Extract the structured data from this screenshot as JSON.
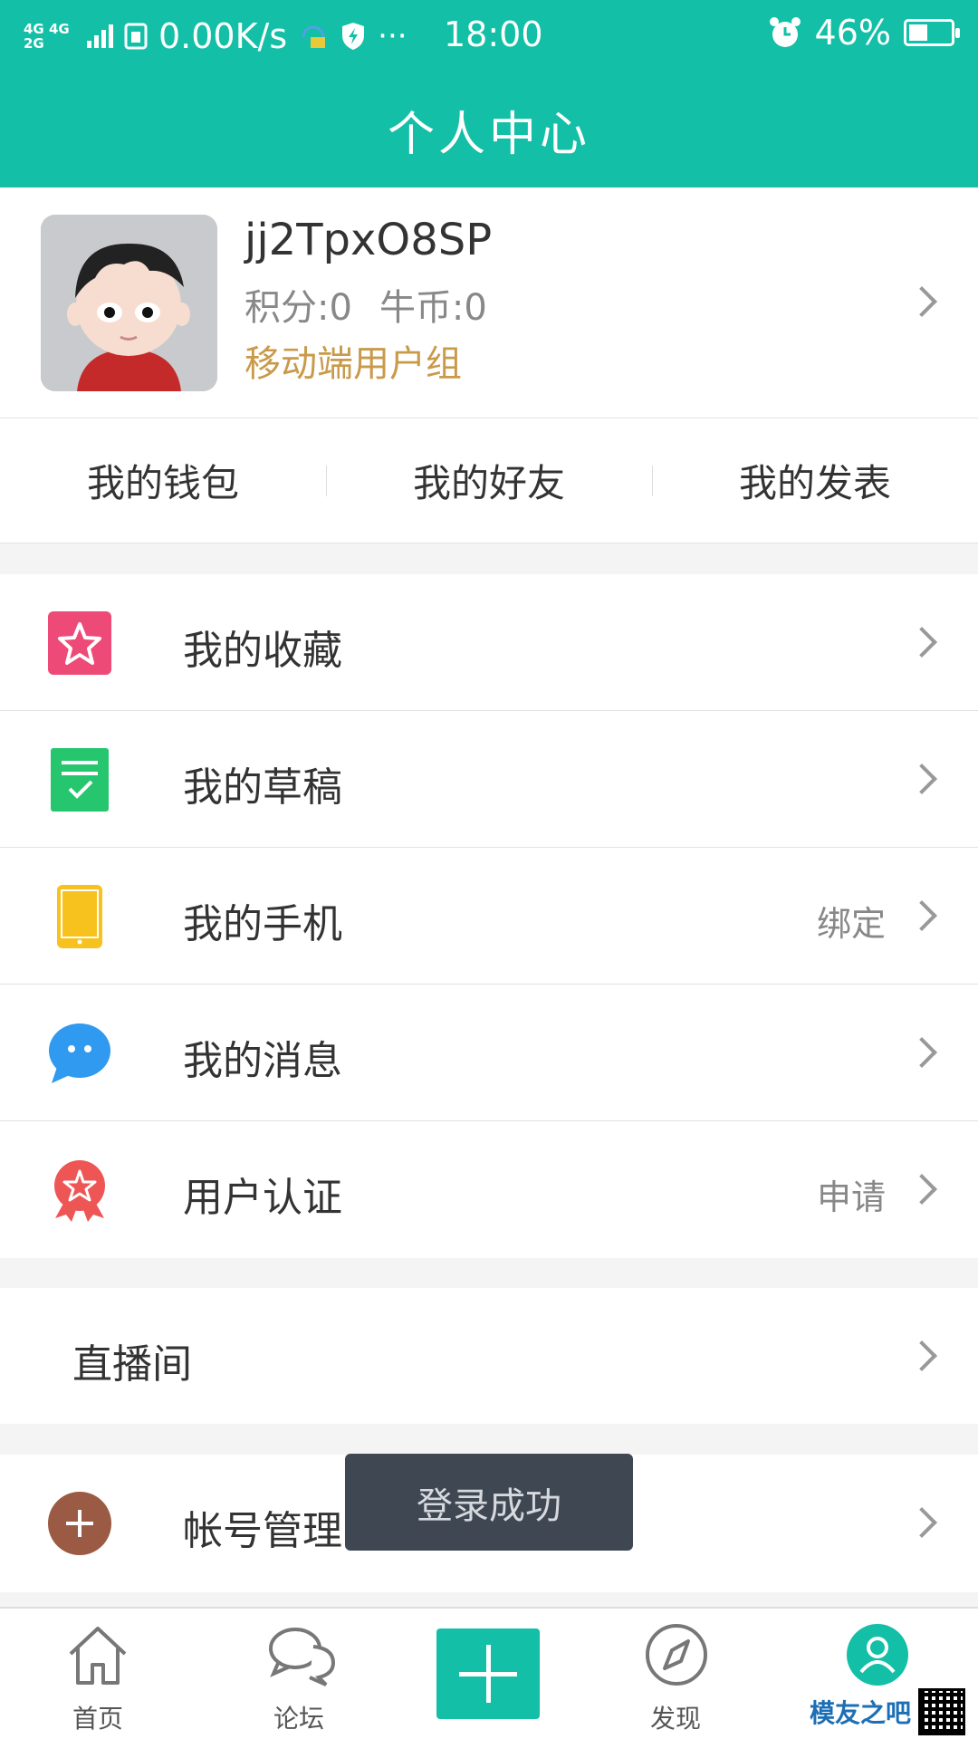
{
  "status_bar": {
    "network": "4G 4G 2G",
    "speed": "0.00K/s",
    "dots": "···",
    "time": "18:00",
    "battery": "46%",
    "battery_level": 0.46
  },
  "header": {
    "title": "个人中心"
  },
  "profile": {
    "username": "jj2TpxO8SP",
    "points": "积分:0",
    "coins": "牛币:0",
    "group": "移动端用户组"
  },
  "quick_links": [
    "我的钱包",
    "我的好友",
    "我的发表"
  ],
  "menu": [
    {
      "label": "我的收藏",
      "icon": "star-icon",
      "color": "#ee4a77",
      "extra": ""
    },
    {
      "label": "我的草稿",
      "icon": "draft-icon",
      "color": "#25c66e",
      "extra": ""
    },
    {
      "label": "我的手机",
      "icon": "phone-icon",
      "color": "#f7c21e",
      "extra": "绑定"
    },
    {
      "label": "我的消息",
      "icon": "message-icon",
      "color": "#2f9af0",
      "extra": ""
    },
    {
      "label": "用户认证",
      "icon": "badge-icon",
      "color": "#ee5656",
      "extra": "申请"
    }
  ],
  "live": {
    "label": "直播间"
  },
  "account": {
    "label": "帐号管理",
    "icon": "plus-circle-icon",
    "color": "#9a5a43"
  },
  "toast": {
    "text": "登录成功"
  },
  "tabbar": {
    "home": "首页",
    "forum": "论坛",
    "discover": "发现",
    "accent": "#13bfa6"
  },
  "watermark": {
    "text": "模友之吧"
  }
}
